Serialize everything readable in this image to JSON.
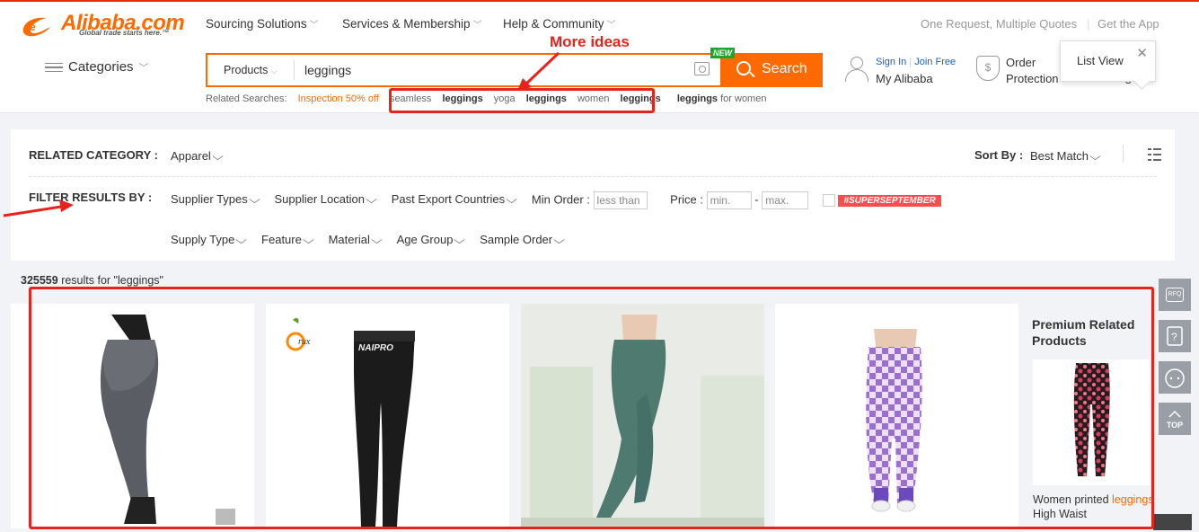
{
  "brand": {
    "name": "Alibaba.com",
    "tagline": "Global trade starts here.™"
  },
  "topnav": {
    "items": [
      {
        "label": "Sourcing Solutions"
      },
      {
        "label": "Services & Membership"
      },
      {
        "label": "Help & Community"
      }
    ],
    "right_links": {
      "quotes": "One Request, Multiple Quotes",
      "app": "Get the App"
    }
  },
  "categories_label": "Categories",
  "search": {
    "scope": "Products",
    "value": "leggings",
    "button": "Search",
    "new_badge": "NEW"
  },
  "related": {
    "label": "Related Searches:",
    "promo": "Inspection 50% off",
    "terms": [
      {
        "pre": "seamless ",
        "kw": "leggings",
        "post": ""
      },
      {
        "pre": "yoga ",
        "kw": "leggings",
        "post": ""
      },
      {
        "pre": "women ",
        "kw": "leggings",
        "post": ""
      },
      {
        "pre": "",
        "kw": "leggings",
        "post": " for women"
      }
    ]
  },
  "user": {
    "sign_in": "Sign In",
    "join": "Join Free",
    "my": "My Alibaba"
  },
  "order_protection": {
    "line1": "Order",
    "line2": "Protection"
  },
  "tooltip": {
    "label": "List View"
  },
  "filters": {
    "related_category_label": "RELATED CATEGORY :",
    "related_category_value": "Apparel",
    "sort_label": "Sort By :",
    "sort_value": "Best Match",
    "filter_label": "FILTER RESULTS BY :",
    "row1": [
      "Supplier Types",
      "Supplier Location",
      "Past Export Countries"
    ],
    "min_order_label": "Min Order :",
    "min_order_placeholder": "less than",
    "price_label": "Price :",
    "price_min": "min.",
    "price_max": "max.",
    "promo_tag": "#SUPERSEPTEMBER",
    "row2": [
      "Supply Type",
      "Feature",
      "Material",
      "Age Group",
      "Sample Order"
    ]
  },
  "results": {
    "count": "325559",
    "text": " results for \"leggings\""
  },
  "products": [
    {
      "name": "grey seamless leggings",
      "color": "#5a5d64"
    },
    {
      "name": "black compression tights",
      "color": "#1b1b1b",
      "print": "NAIPRO",
      "logo": "rux"
    },
    {
      "name": "green high waist leggings",
      "color": "#4e7a6f"
    },
    {
      "name": "purple checkered leggings",
      "color": "#9a6fd0"
    }
  ],
  "premium": {
    "title": "Premium Related Products",
    "desc_pre": "Women printed ",
    "desc_kw": "leggings",
    "desc_post": " High Waist"
  },
  "side_tools": [
    {
      "label": "RFQ"
    },
    {
      "label": ""
    },
    {
      "label": ""
    },
    {
      "label": "TOP"
    }
  ],
  "annotations": {
    "more_ideas": "More ideas",
    "color": "#e8221c"
  }
}
